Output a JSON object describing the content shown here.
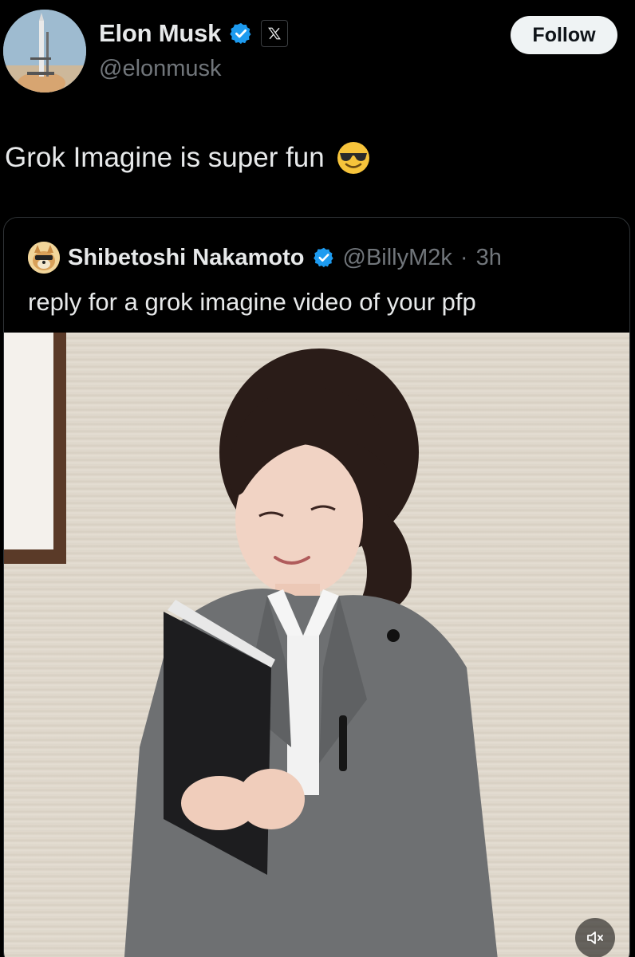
{
  "author": {
    "display_name": "Elon Musk",
    "handle": "@elonmusk",
    "avatar_icon": "rocket-launch-avatar",
    "verified_icon": "verified-badge-icon",
    "affiliation_icon": "x-logo-icon"
  },
  "follow_button": {
    "label": "Follow"
  },
  "tweet": {
    "text": "Grok Imagine is super fun",
    "emoji_icon": "sunglasses-emoji-icon"
  },
  "quote": {
    "display_name": "Shibetoshi Nakamoto",
    "handle": "@BillyM2k",
    "separator": "·",
    "time": "3h",
    "text": "reply for a grok imagine video of your pfp",
    "avatar_icon": "doge-avatar"
  },
  "media": {
    "type": "video",
    "mute_icon": "volume-muted-icon"
  },
  "colors": {
    "background": "#000000",
    "text_primary": "#e7e9ea",
    "text_secondary": "#71767b",
    "verified_blue": "#1d9bf0",
    "follow_bg": "#eff3f4",
    "border": "#2f3336"
  }
}
